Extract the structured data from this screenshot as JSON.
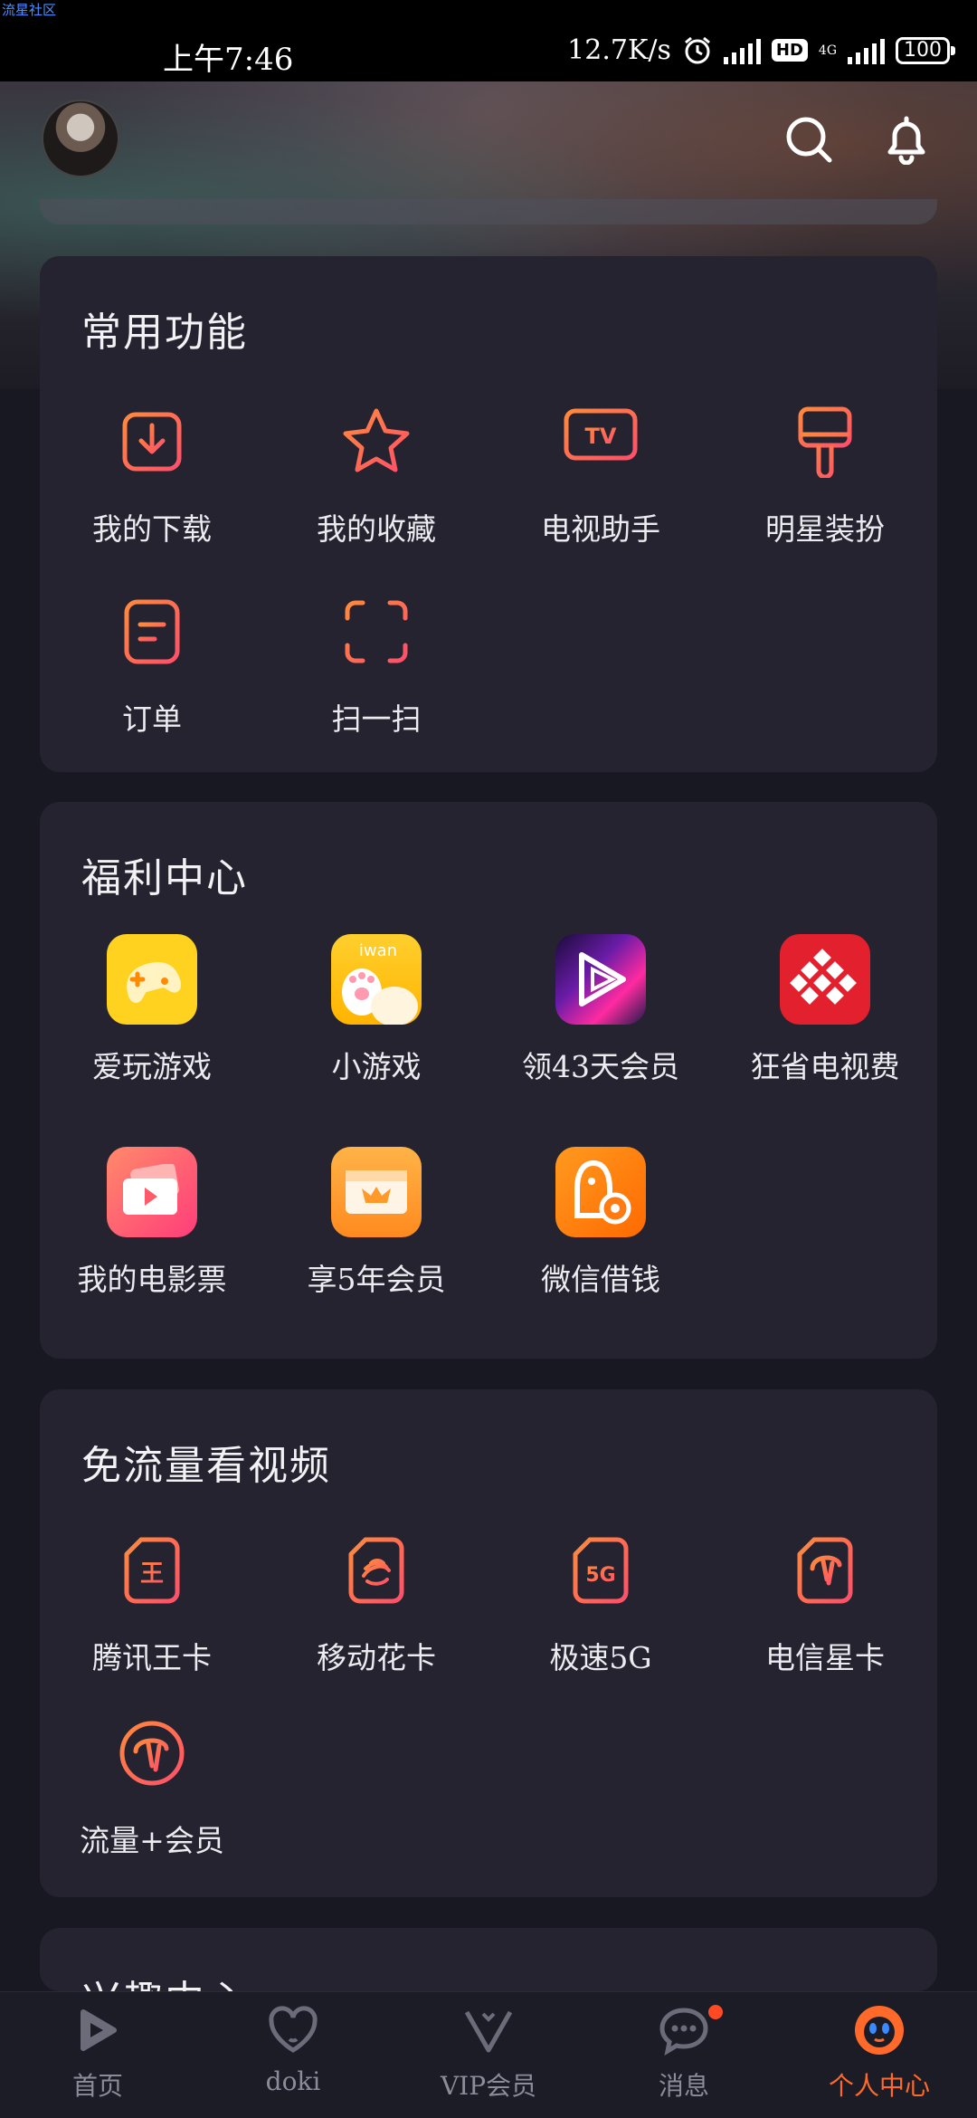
{
  "watermark": "流星社区",
  "status_bar": {
    "time": "上午7:46",
    "speed": "12.7K/s",
    "hd": "HD",
    "net": "4G",
    "battery": "100"
  },
  "colors": {
    "accent": "#ff6a2a",
    "card_bg": "#24232f",
    "page_bg": "#181822"
  },
  "header": {
    "icons": [
      "search-icon",
      "bell-icon"
    ]
  },
  "sections": {
    "common": {
      "title": "常用功能",
      "items": [
        {
          "label": "我的下载",
          "icon": "download-icon"
        },
        {
          "label": "我的收藏",
          "icon": "star-icon"
        },
        {
          "label": "电视助手",
          "icon": "tv-icon"
        },
        {
          "label": "明星装扮",
          "icon": "brush-icon"
        },
        {
          "label": "订单",
          "icon": "order-icon"
        },
        {
          "label": "扫一扫",
          "icon": "scan-icon"
        }
      ]
    },
    "welfare": {
      "title": "福利中心",
      "items": [
        {
          "label": "爱玩游戏",
          "icon": "gamepad-app-icon"
        },
        {
          "label": "小游戏",
          "icon": "iwan-app-icon",
          "badge_text": "iwan"
        },
        {
          "label": "领43天会员",
          "icon": "video-play-app-icon"
        },
        {
          "label": "狂省电视费",
          "icon": "tv-saver-app-icon"
        },
        {
          "label": "我的电影票",
          "icon": "movie-ticket-app-icon"
        },
        {
          "label": "享5年会员",
          "icon": "crown-card-app-icon"
        },
        {
          "label": "微信借钱",
          "icon": "penguin-coin-app-icon"
        }
      ]
    },
    "free_data": {
      "title": "免流量看视频",
      "items": [
        {
          "label": "腾讯王卡",
          "icon": "sim-wang-icon",
          "glyph": "王"
        },
        {
          "label": "移动花卡",
          "icon": "sim-mobile-icon"
        },
        {
          "label": "极速5G",
          "icon": "sim-5g-icon",
          "glyph": "5G"
        },
        {
          "label": "电信星卡",
          "icon": "sim-telecom-icon"
        },
        {
          "label": "流量+会员",
          "icon": "telecom-circle-icon"
        }
      ]
    },
    "interest": {
      "title": "兴趣中心"
    }
  },
  "tabbar": [
    {
      "label": "首页",
      "icon": "home-play-icon"
    },
    {
      "label": "doki",
      "icon": "doki-heart-icon"
    },
    {
      "label": "VIP会员",
      "icon": "vip-icon"
    },
    {
      "label": "消息",
      "icon": "message-icon"
    },
    {
      "label": "个人中心",
      "icon": "profile-icon",
      "active": true
    }
  ]
}
